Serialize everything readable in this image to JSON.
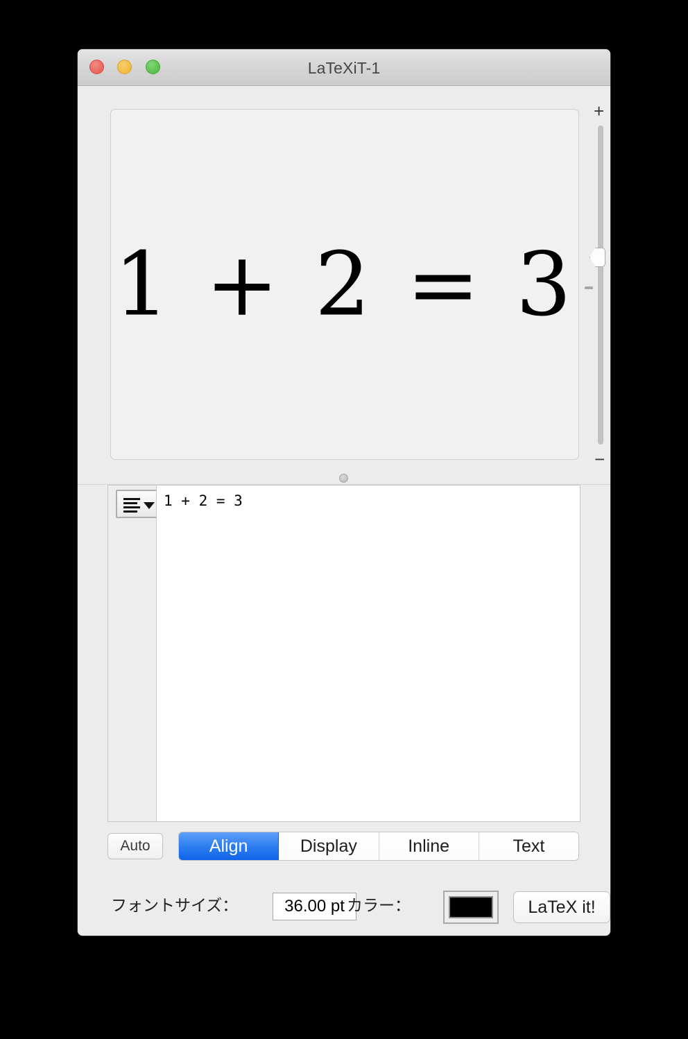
{
  "window": {
    "title": "LaTeXiT-1",
    "traffic_lights": {
      "close": "close-button",
      "minimize": "minimize-button",
      "maximize": "maximize-button"
    }
  },
  "preview": {
    "equation": "1 + 2 = 3",
    "background_color": "#f1f1f1"
  },
  "zoom_slider": {
    "plus_label": "+",
    "minus_label": "−"
  },
  "editor": {
    "menu_icon": "list-menu-icon",
    "caret_icon": "chevron-down-icon",
    "content": "1 + 2 = 3"
  },
  "mode_bar": {
    "auto_label": "Auto",
    "segments": [
      {
        "label": "Align",
        "selected": true
      },
      {
        "label": "Display",
        "selected": false
      },
      {
        "label": "Inline",
        "selected": false
      },
      {
        "label": "Text",
        "selected": false
      }
    ],
    "accent_color": "#2f7ef0"
  },
  "options": {
    "fontsize_label": "フォントサイズ：",
    "fontsize_value": "36.00 pt",
    "color_label": "カラー：",
    "color_value": "#000000",
    "latexit_label": "LaTeX it!"
  }
}
